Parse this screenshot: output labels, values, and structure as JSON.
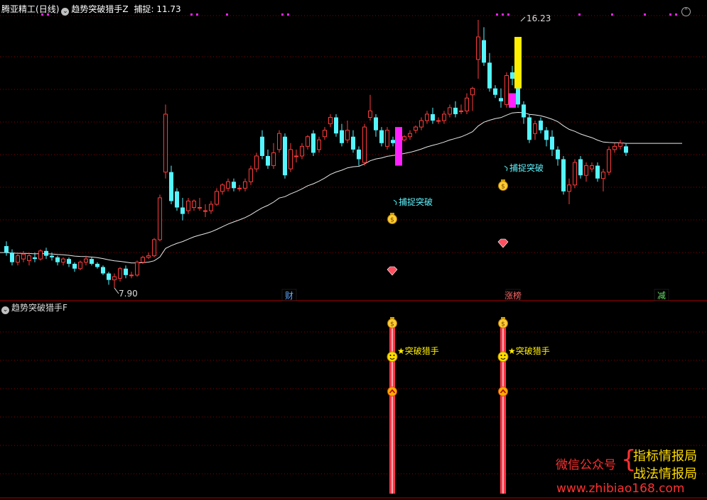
{
  "header": {
    "stock_name": "腾亚精工",
    "period": "(日线)",
    "indicator_name": "趋势突破猎手Z",
    "capture_label": "捕捉:",
    "capture_value": "11.73"
  },
  "sub_header": {
    "indicator_name": "趋势突破猎手F"
  },
  "price_labels": {
    "high": "16.23",
    "low": "7.90"
  },
  "signals": {
    "capture_breakout": "捕捉突破",
    "hunter": "突破猎手"
  },
  "event_tags": [
    {
      "text": "财",
      "color": "#5fa8ff"
    },
    {
      "text": "涨榜",
      "color": "#ff6666"
    },
    {
      "text": "减",
      "color": "#66dd66"
    }
  ],
  "watermark": {
    "left": "微信公众号",
    "right_top": "指标情报局",
    "right_bottom": "战法情报局",
    "url": "www.zhibiao168.com"
  },
  "colors": {
    "up": "#ff3b3b",
    "down": "#54f5ff",
    "ma": "#e8e8e8",
    "grid": "#8b0000",
    "signal_yellow": "#ffee00",
    "signal_magenta": "#ff22ff",
    "watermark_red": "#ff3030",
    "watermark_yellow": "#ffdd00"
  },
  "chart_data": {
    "type": "candlestick",
    "high_marker": 16.23,
    "low_marker": 7.9,
    "candles": [
      [
        9.2,
        9.0,
        9.35,
        8.9
      ],
      [
        9.0,
        8.7,
        9.1,
        8.6
      ],
      [
        8.7,
        8.9,
        9.0,
        8.6
      ],
      [
        8.8,
        8.95,
        9.05,
        8.7
      ],
      [
        8.75,
        8.9,
        9.0,
        8.6
      ],
      [
        8.85,
        8.8,
        9.0,
        8.7
      ],
      [
        8.8,
        9.05,
        9.1,
        8.75
      ],
      [
        9.05,
        8.9,
        9.15,
        8.8
      ],
      [
        8.9,
        8.85,
        9.0,
        8.75
      ],
      [
        8.85,
        8.7,
        8.9,
        8.6
      ],
      [
        8.7,
        8.8,
        8.85,
        8.6
      ],
      [
        8.8,
        8.65,
        8.85,
        8.55
      ],
      [
        8.65,
        8.5,
        8.7,
        8.4
      ],
      [
        8.5,
        8.7,
        8.75,
        8.45
      ],
      [
        8.7,
        8.8,
        8.9,
        8.6
      ],
      [
        8.8,
        8.65,
        8.85,
        8.6
      ],
      [
        8.65,
        8.55,
        8.7,
        8.5
      ],
      [
        8.55,
        8.35,
        8.6,
        8.3
      ],
      [
        8.35,
        8.15,
        8.4,
        8.0
      ],
      [
        8.15,
        8.25,
        8.35,
        7.9
      ],
      [
        8.2,
        8.5,
        8.55,
        8.1
      ],
      [
        8.5,
        8.3,
        8.6,
        8.2
      ],
      [
        8.3,
        8.3,
        8.4,
        8.2
      ],
      [
        8.3,
        8.7,
        8.75,
        8.25
      ],
      [
        8.7,
        8.85,
        8.9,
        8.65
      ],
      [
        8.85,
        8.9,
        9.0,
        8.8
      ],
      [
        8.9,
        9.4,
        9.45,
        8.85
      ],
      [
        9.4,
        10.7,
        10.8,
        9.35
      ],
      [
        11.5,
        13.3,
        13.6,
        11.3
      ],
      [
        11.5,
        10.6,
        11.7,
        10.5
      ],
      [
        10.9,
        10.4,
        11.0,
        10.3
      ],
      [
        10.4,
        10.2,
        10.7,
        10.0
      ],
      [
        10.3,
        10.6,
        10.7,
        10.2
      ],
      [
        10.4,
        10.6,
        10.65,
        10.3
      ],
      [
        10.4,
        10.4,
        10.7,
        10.3
      ],
      [
        10.3,
        10.3,
        10.5,
        10.1
      ],
      [
        10.3,
        10.5,
        10.6,
        10.2
      ],
      [
        10.5,
        10.9,
        11.0,
        10.45
      ],
      [
        10.9,
        11.1,
        11.15,
        10.8
      ],
      [
        11.0,
        11.2,
        11.3,
        10.9
      ],
      [
        11.2,
        11.0,
        11.3,
        10.9
      ],
      [
        11.0,
        11.0,
        11.1,
        10.9
      ],
      [
        11.0,
        11.2,
        11.3,
        10.9
      ],
      [
        11.2,
        11.6,
        11.7,
        11.1
      ],
      [
        11.6,
        12.0,
        12.1,
        11.5
      ],
      [
        12.6,
        12.0,
        12.8,
        11.9
      ],
      [
        12.0,
        11.7,
        12.2,
        11.6
      ],
      [
        11.7,
        12.1,
        12.4,
        11.6
      ],
      [
        12.2,
        12.7,
        12.8,
        12.1
      ],
      [
        12.6,
        11.4,
        12.7,
        11.3
      ],
      [
        11.6,
        12.2,
        12.4,
        11.5
      ],
      [
        12.0,
        12.0,
        12.2,
        11.8
      ],
      [
        12.0,
        12.3,
        12.4,
        11.9
      ],
      [
        12.3,
        12.6,
        12.65,
        12.2
      ],
      [
        12.7,
        12.1,
        12.8,
        12.0
      ],
      [
        12.2,
        12.5,
        12.6,
        12.1
      ],
      [
        12.6,
        12.8,
        12.9,
        12.5
      ],
      [
        13.0,
        13.2,
        13.3,
        12.9
      ],
      [
        13.2,
        12.7,
        13.3,
        12.6
      ],
      [
        12.8,
        12.4,
        13.0,
        12.3
      ],
      [
        12.5,
        12.8,
        13.1,
        12.4
      ],
      [
        12.6,
        12.2,
        12.8,
        12.1
      ],
      [
        12.2,
        11.9,
        12.3,
        11.7
      ],
      [
        11.8,
        12.9,
        13.0,
        11.7
      ],
      [
        13.2,
        13.4,
        13.9,
        13.1
      ],
      [
        13.2,
        12.8,
        13.3,
        12.6
      ],
      [
        12.8,
        12.4,
        12.9,
        12.3
      ],
      [
        12.3,
        12.8,
        12.9,
        12.2
      ],
      [
        12.5,
        12.4,
        12.6,
        12.3
      ],
      [
        12.4,
        12.5,
        12.7,
        12.3
      ],
      [
        12.5,
        12.6,
        12.65,
        12.45
      ],
      [
        12.6,
        12.7,
        12.8,
        12.5
      ],
      [
        12.8,
        12.9,
        12.95,
        12.7
      ],
      [
        12.9,
        13.1,
        13.2,
        12.8
      ],
      [
        13.1,
        13.3,
        13.4,
        13.0
      ],
      [
        13.3,
        13.1,
        13.5,
        13.0
      ],
      [
        13.1,
        13.1,
        13.2,
        13.0
      ],
      [
        13.1,
        13.3,
        13.4,
        13.0
      ],
      [
        13.3,
        13.5,
        13.6,
        13.2
      ],
      [
        13.5,
        13.3,
        13.7,
        13.2
      ],
      [
        13.4,
        13.4,
        13.6,
        13.3
      ],
      [
        13.4,
        13.8,
        13.95,
        13.3
      ],
      [
        13.9,
        14.1,
        14.15,
        13.4
      ],
      [
        15.0,
        15.7,
        16.23,
        14.4
      ],
      [
        15.6,
        14.9,
        16.0,
        14.8
      ],
      [
        14.9,
        14.1,
        15.2,
        14.0
      ],
      [
        14.1,
        13.9,
        14.2,
        13.8
      ],
      [
        13.8,
        13.7,
        14.1,
        13.5
      ],
      [
        13.6,
        14.5,
        14.6,
        13.5
      ],
      [
        14.6,
        14.4,
        14.8,
        14.2
      ],
      [
        14.5,
        13.6,
        14.7,
        13.5
      ],
      [
        13.6,
        13.2,
        13.7,
        13.0
      ],
      [
        13.2,
        12.5,
        13.3,
        12.4
      ],
      [
        12.7,
        13.0,
        13.1,
        12.5
      ],
      [
        13.1,
        12.8,
        13.2,
        12.7
      ],
      [
        12.8,
        12.5,
        12.9,
        12.3
      ],
      [
        12.6,
        12.2,
        12.8,
        12.0
      ],
      [
        12.2,
        11.9,
        12.3,
        11.7
      ],
      [
        11.9,
        10.9,
        12.0,
        10.8
      ],
      [
        10.9,
        11.1,
        11.3,
        10.5
      ],
      [
        11.1,
        11.8,
        11.9,
        11.0
      ],
      [
        11.9,
        11.4,
        12.0,
        11.3
      ],
      [
        11.4,
        11.7,
        11.8,
        11.2
      ],
      [
        11.6,
        11.7,
        11.8,
        11.5
      ],
      [
        11.7,
        11.3,
        11.8,
        11.2
      ],
      [
        11.3,
        11.5,
        11.6,
        10.9
      ],
      [
        11.5,
        12.2,
        12.3,
        11.4
      ],
      [
        12.2,
        12.3,
        12.4,
        12.1
      ],
      [
        12.3,
        12.4,
        12.5,
        12.2
      ],
      [
        12.3,
        12.1,
        12.4,
        12.0
      ]
    ],
    "signal_bars": [
      {
        "index": 69,
        "bottom": 11.7,
        "top": 12.9,
        "color": "#ff22ff"
      },
      {
        "index": 90,
        "bottom": 14.1,
        "top": 15.7,
        "color": "#ffee00"
      },
      {
        "index": 89,
        "bottom": 13.5,
        "top": 13.95,
        "color": "#ff22ff"
      }
    ]
  }
}
